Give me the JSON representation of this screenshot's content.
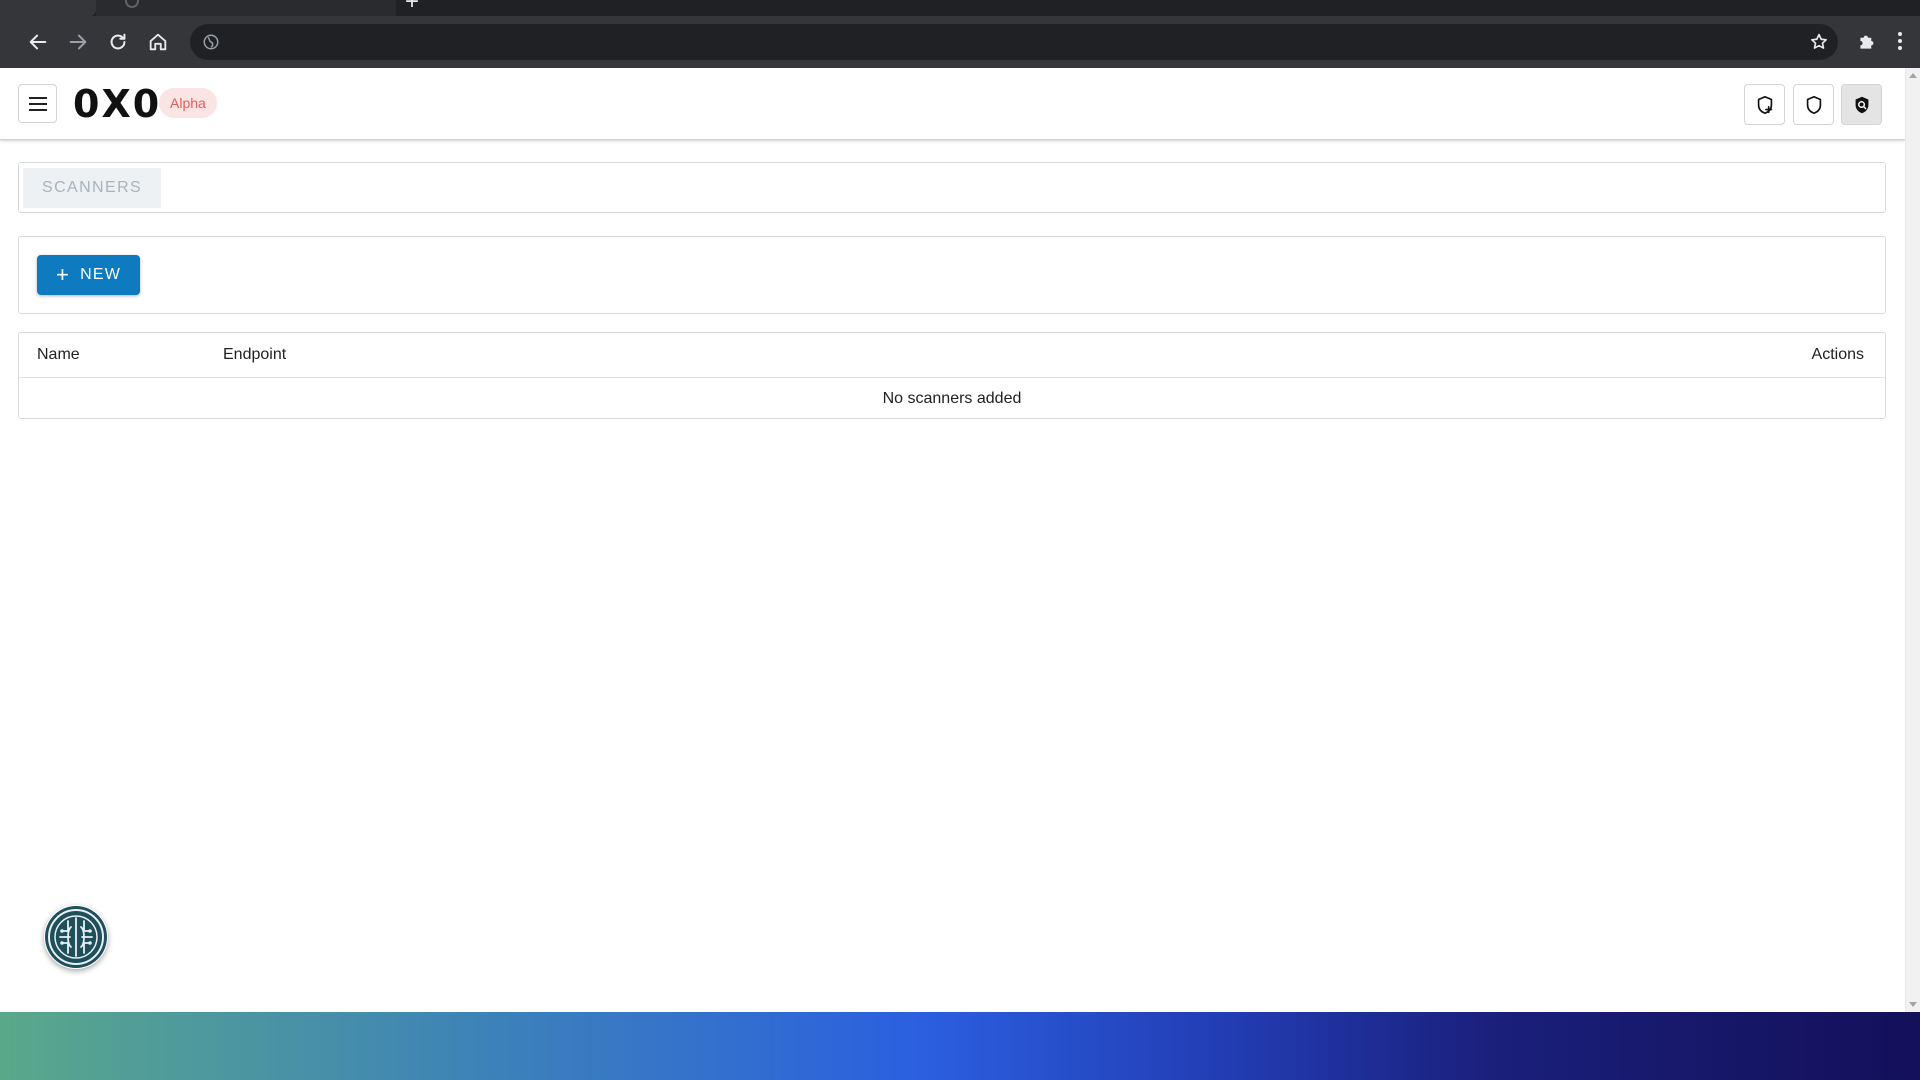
{
  "app": {
    "logo": "0X0",
    "badge": "Alpha"
  },
  "tabs": {
    "scanners": "SCANNERS"
  },
  "actions": {
    "new_label": "NEW"
  },
  "table": {
    "columns": {
      "name": "Name",
      "endpoint": "Endpoint",
      "actions": "Actions"
    },
    "empty_message": "No scanners added"
  },
  "header_icons": [
    "shield-plus-icon",
    "shield-icon",
    "shield-search-icon"
  ],
  "colors": {
    "primary": "#0e7abf",
    "badge_bg": "#fbe4e4",
    "badge_text": "#e25b5b",
    "tab_text": "#a7b4bc"
  }
}
